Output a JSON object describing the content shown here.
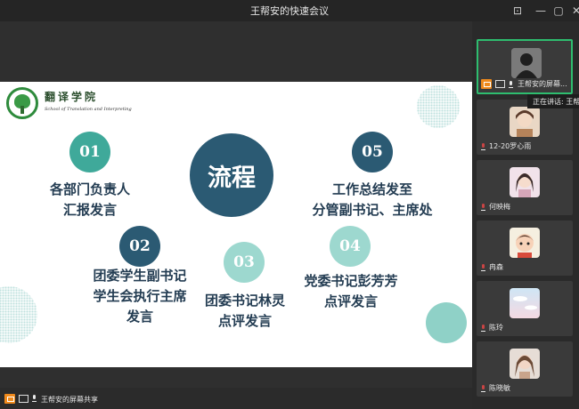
{
  "window": {
    "title": "王帮安的快速会议",
    "minimize_glyph": "—",
    "restore_glyph": "▢",
    "close_glyph": "✕",
    "pin_glyph": "⊡"
  },
  "slide": {
    "school_cn": "翻译学院",
    "school_en": "School of Translation and Interpreting",
    "center_label": "流程",
    "steps": [
      {
        "number": "01",
        "lines": [
          "各部门负责人",
          "汇报发言"
        ]
      },
      {
        "number": "02",
        "lines": [
          "团委学生副书记",
          "学生会执行主席",
          "发言"
        ]
      },
      {
        "number": "03",
        "lines": [
          "团委书记林灵",
          "点评发言"
        ]
      },
      {
        "number": "04",
        "lines": [
          "党委书记彭芳芳",
          "点评发言"
        ]
      },
      {
        "number": "05",
        "lines": [
          "工作总结发至",
          "分管副书记、主席处"
        ]
      }
    ],
    "colors": {
      "teal": "#3fa99a",
      "navy": "#2b5a73",
      "light": "#9dd8cf"
    }
  },
  "participants": [
    {
      "name": "王帮安的屏幕...",
      "active": true,
      "sharing": true
    },
    {
      "name": "12-20罗心雨"
    },
    {
      "name": "何映梅"
    },
    {
      "name": "冉森"
    },
    {
      "name": "陈玲"
    },
    {
      "name": "陈晓敏"
    }
  ],
  "tooltip": "正在讲话: 王帮",
  "bottom": {
    "label": "王帮安的屏幕共享"
  }
}
